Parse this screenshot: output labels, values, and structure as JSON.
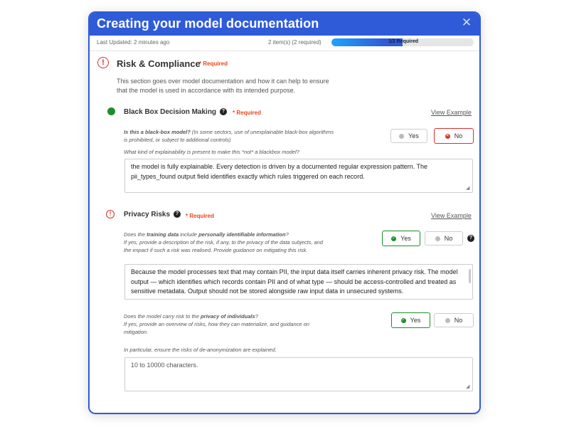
{
  "modal": {
    "title": "Creating your model documentation",
    "close_glyph": "✕"
  },
  "status": {
    "last_updated": "Last Updated: 2 minutes ago",
    "items": "2 item(s) (2 required)",
    "progress_label": "1/2 Required",
    "progress_fraction": 0.5
  },
  "section": {
    "icon_glyph": "!",
    "title": "Risk & Compliance",
    "required": "* Required",
    "description_line1": "This section goes over model documentation and how it can help to ensure",
    "description_line2": "that the model is used in accordance with its intended purpose."
  },
  "black_box": {
    "title": "Black Box Decision Making",
    "help_glyph": "?",
    "required": "* Required",
    "view_example": "View Example",
    "q_bold": "Is this a black-box model?",
    "q_rest_line1": " (In some sectors, use of unexplainable black-box algorithms",
    "q_line2": "is prohibited, or subject to additional controls)",
    "sub_question": "What kind of explainability is present to make this *not* a blackbox model?",
    "yes_label": "Yes",
    "no_label": "No",
    "selected": "No",
    "answer": "the model is fully explainable. Every detection is driven by a documented regular expression pattern. The pii_types_found output field identifies exactly which rules triggered on each record."
  },
  "privacy": {
    "icon_glyph": "!",
    "title": "Privacy Risks",
    "help_glyph": "?",
    "required": "* Required",
    "view_example": "View Example",
    "q1_pre": "Does the ",
    "q1_bold1": "training data",
    "q1_mid": " include ",
    "q1_bold2": "personally identifiable information",
    "q1_end": "?",
    "q1_line2": "If yes, provide a description of the risk, if any, to the privacy of the data subjects, and",
    "q1_line3": "the impact if such a risk was realised. Provide guidance on mitigating this risk.",
    "q1_yes": "Yes",
    "q1_no": "No",
    "q1_selected": "Yes",
    "q1_answer": "Because the model processes text that may contain PII, the input data itself carries inherent privacy risk. The model output — which identifies which records contain PII and of what type — should be access-controlled and treated as sensitive metadata. Output should not be stored alongside raw input data in unsecured systems.",
    "q2_pre": "Does the model carry risk to the ",
    "q2_bold": "privacy of individuals",
    "q2_end": "?",
    "q2_line2": "If yes, provide an overview of risks, how they can materialize, and guidance on",
    "q2_line3": "mitigation.",
    "q2_yes": "Yes",
    "q2_no": "No",
    "q2_selected": "Yes",
    "q2_note": "In particular, ensure the risks of de-anonymization are explained.",
    "q2_placeholder": "10 to 10000 characters."
  },
  "colors": {
    "brand_blue": "#2f5bd8",
    "required_red": "#e8451a",
    "error_red": "#d9302c",
    "success_green": "#1b8f2a"
  }
}
